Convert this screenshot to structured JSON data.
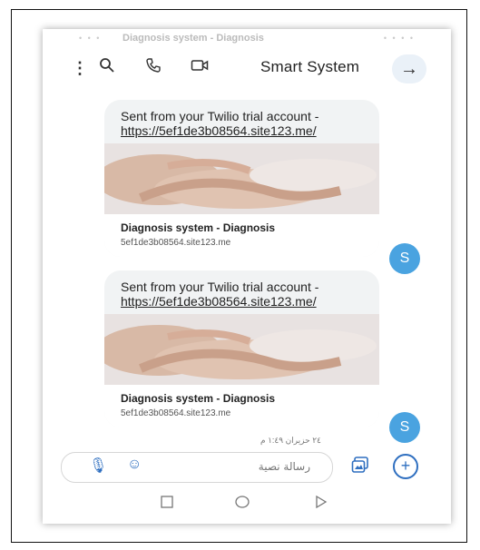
{
  "statusbar": {
    "ghost_title": "Diagnosis system - Diagnosis"
  },
  "topbar": {
    "contact_name": "Smart System",
    "icons": [
      "more-vert-icon",
      "search-icon",
      "phone-icon",
      "video-icon",
      "arrow-right-icon"
    ]
  },
  "messages": [
    {
      "text_line": "Sent from your Twilio trial account - ",
      "link": "https://5ef1de3b08564.site123.me/",
      "preview_title": "Diagnosis system - Diagnosis",
      "preview_url": "5ef1de3b08564.site123.me",
      "sender_initial": "S"
    },
    {
      "text_line": "Sent from your Twilio trial account - ",
      "link": "https://5ef1de3b08564.site123.me/",
      "preview_title": "Diagnosis system - Diagnosis",
      "preview_url": "5ef1de3b08564.site123.me",
      "sender_initial": "S"
    }
  ],
  "timestamp": "٢٤ حزيران ١:٤٩ م",
  "composer": {
    "placeholder": "رسالة نصية"
  },
  "colors": {
    "accent": "#2f6fc0",
    "avatar": "#4aa3e0",
    "bubble": "#f1f3f4"
  }
}
